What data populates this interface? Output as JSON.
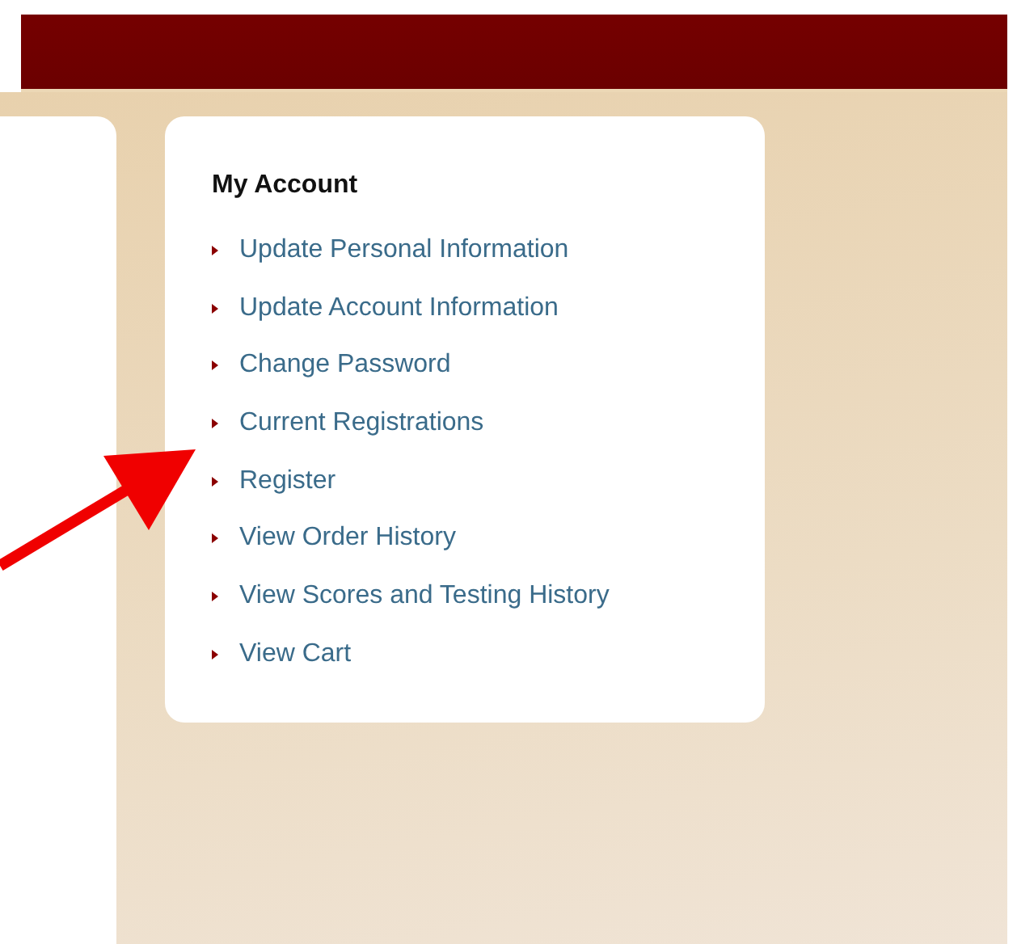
{
  "account_menu": {
    "title": "My Account",
    "links": [
      {
        "label": "Update Personal Information"
      },
      {
        "label": "Update Account Information"
      },
      {
        "label": "Change Password"
      },
      {
        "label": "Current Registrations"
      },
      {
        "label": "Register"
      },
      {
        "label": "View Order History"
      },
      {
        "label": "View Scores and Testing History"
      },
      {
        "label": "View Cart"
      }
    ]
  }
}
